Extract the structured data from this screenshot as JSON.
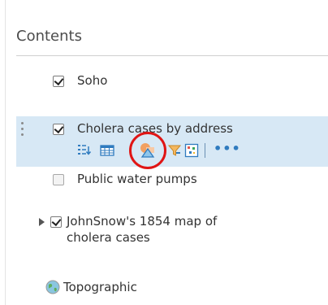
{
  "panel": {
    "title": "Contents"
  },
  "layers": [
    {
      "label": "Soho",
      "checked": true
    },
    {
      "label": "Cholera cases by address",
      "checked": true,
      "selected": true
    },
    {
      "label": "Public water pumps",
      "checked": false
    },
    {
      "label_line1": "JohnSnow's 1854 map of",
      "label_line2": "cholera cases",
      "checked": true,
      "expandable": true
    }
  ],
  "basemap": {
    "label": "Topographic",
    "icon": "globe-icon"
  },
  "toolbar": {
    "items": [
      {
        "icon": "legend-icon"
      },
      {
        "icon": "table-icon"
      },
      {
        "icon": "change-style-icon",
        "circled": true
      },
      {
        "icon": "filter-icon"
      },
      {
        "icon": "analysis-icon"
      },
      {
        "icon": "more-options-icon",
        "text": "•••"
      }
    ]
  },
  "colors": {
    "selected_row": "#d7e8f5",
    "annotation_circle": "#e01515",
    "accent": "#2f7bbf"
  }
}
